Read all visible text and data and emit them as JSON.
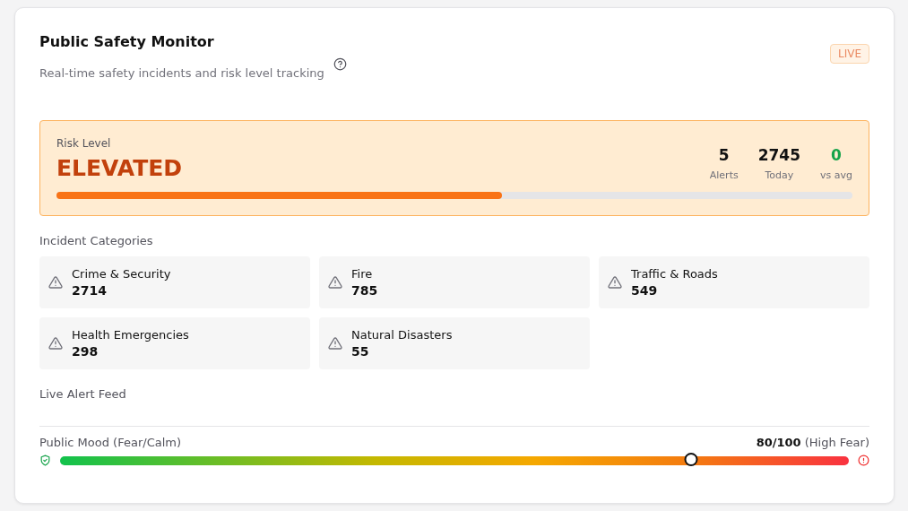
{
  "header": {
    "title": "Public Safety Monitor",
    "subtitle": "Real-time safety incidents and risk level tracking",
    "badge": "LIVE"
  },
  "risk": {
    "label": "Risk Level",
    "value": "ELEVATED",
    "level": 0.56,
    "stats": [
      {
        "value": "5",
        "label": "Alerts",
        "kind": "neutral"
      },
      {
        "value": "2745",
        "label": "Today",
        "kind": "neutral"
      },
      {
        "value": "0",
        "label": "vs avg",
        "kind": "good"
      }
    ]
  },
  "categories": {
    "title": "Incident Categories",
    "items": [
      {
        "name": "Crime & Security",
        "count": "2714"
      },
      {
        "name": "Fire",
        "count": "785"
      },
      {
        "name": "Traffic & Roads",
        "count": "549"
      },
      {
        "name": "Health Emergencies",
        "count": "298"
      },
      {
        "name": "Natural Disasters",
        "count": "55"
      }
    ]
  },
  "feed": {
    "title": "Live Alert Feed"
  },
  "mood": {
    "label": "Public Mood (Fear/Calm)",
    "score": "80/100",
    "status": "(High Fear)",
    "level": 0.8
  }
}
